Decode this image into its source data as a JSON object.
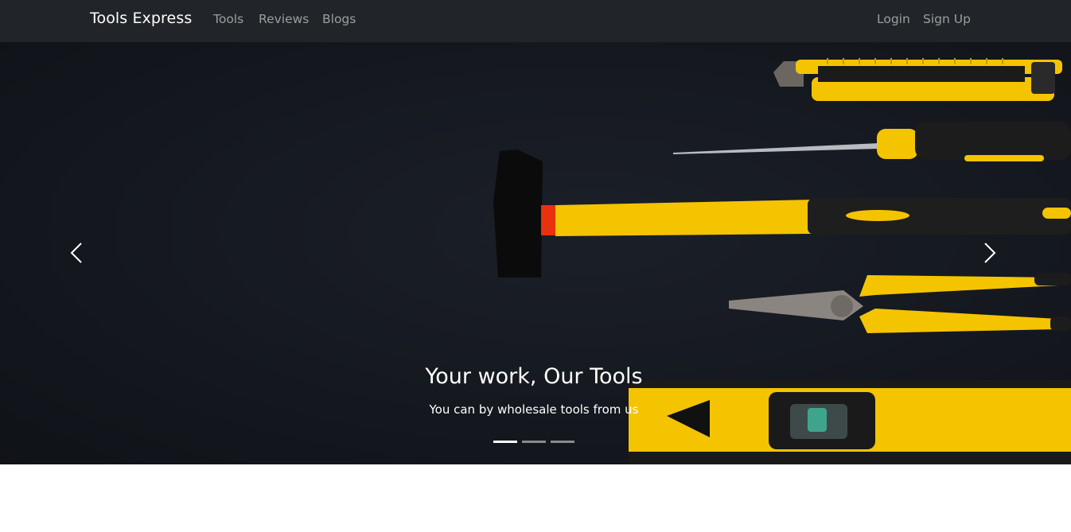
{
  "navbar": {
    "brand": "Tools Express",
    "links": [
      {
        "label": "Tools"
      },
      {
        "label": "Reviews"
      },
      {
        "label": "Blogs"
      }
    ],
    "auth": {
      "login": "Login",
      "signup": "Sign Up"
    }
  },
  "carousel": {
    "caption_title": "Your work, Our Tools",
    "caption_text": "You can by wholesale tools from us",
    "slide_count": 3,
    "active_slide": 1,
    "prev_icon": "chevron-left-icon",
    "next_icon": "chevron-right-icon"
  },
  "colors": {
    "navbar_bg": "#212529",
    "hero_bg": "#12151c",
    "tool_yellow": "#f5c400",
    "white": "#ffffff"
  }
}
